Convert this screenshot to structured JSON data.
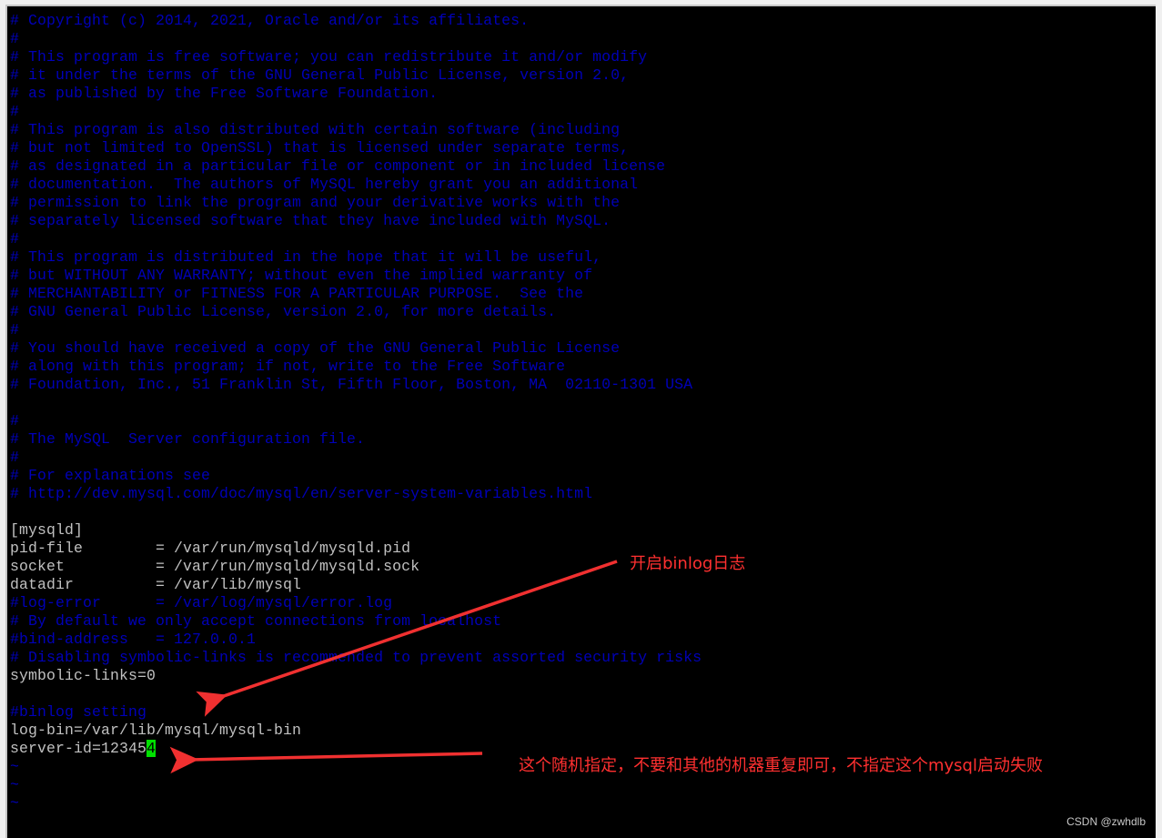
{
  "terminal": {
    "lines": [
      {
        "text": "# Copyright (c) 2014, 2021, Oracle and/or its affiliates.",
        "kind": "comment"
      },
      {
        "text": "#",
        "kind": "comment"
      },
      {
        "text": "# This program is free software; you can redistribute it and/or modify",
        "kind": "comment"
      },
      {
        "text": "# it under the terms of the GNU General Public License, version 2.0,",
        "kind": "comment"
      },
      {
        "text": "# as published by the Free Software Foundation.",
        "kind": "comment"
      },
      {
        "text": "#",
        "kind": "comment"
      },
      {
        "text": "# This program is also distributed with certain software (including",
        "kind": "comment"
      },
      {
        "text": "# but not limited to OpenSSL) that is licensed under separate terms,",
        "kind": "comment"
      },
      {
        "text": "# as designated in a particular file or component or in included license",
        "kind": "comment"
      },
      {
        "text": "# documentation.  The authors of MySQL hereby grant you an additional",
        "kind": "comment"
      },
      {
        "text": "# permission to link the program and your derivative works with the",
        "kind": "comment"
      },
      {
        "text": "# separately licensed software that they have included with MySQL.",
        "kind": "comment"
      },
      {
        "text": "#",
        "kind": "comment"
      },
      {
        "text": "# This program is distributed in the hope that it will be useful,",
        "kind": "comment"
      },
      {
        "text": "# but WITHOUT ANY WARRANTY; without even the implied warranty of",
        "kind": "comment"
      },
      {
        "text": "# MERCHANTABILITY or FITNESS FOR A PARTICULAR PURPOSE.  See the",
        "kind": "comment"
      },
      {
        "text": "# GNU General Public License, version 2.0, for more details.",
        "kind": "comment"
      },
      {
        "text": "#",
        "kind": "comment"
      },
      {
        "text": "# You should have received a copy of the GNU General Public License",
        "kind": "comment"
      },
      {
        "text": "# along with this program; if not, write to the Free Software",
        "kind": "comment"
      },
      {
        "text": "# Foundation, Inc., 51 Franklin St, Fifth Floor, Boston, MA  02110-1301 USA",
        "kind": "comment"
      },
      {
        "text": "",
        "kind": "text"
      },
      {
        "text": "#",
        "kind": "comment"
      },
      {
        "text": "# The MySQL  Server configuration file.",
        "kind": "comment"
      },
      {
        "text": "#",
        "kind": "comment"
      },
      {
        "text": "# For explanations see",
        "kind": "comment"
      },
      {
        "text": "# http://dev.mysql.com/doc/mysql/en/server-system-variables.html",
        "kind": "comment"
      },
      {
        "text": "",
        "kind": "text"
      },
      {
        "text": "[mysqld]",
        "kind": "text"
      },
      {
        "text": "pid-file        = /var/run/mysqld/mysqld.pid",
        "kind": "text"
      },
      {
        "text": "socket          = /var/run/mysqld/mysqld.sock",
        "kind": "text"
      },
      {
        "text": "datadir         = /var/lib/mysql",
        "kind": "text"
      },
      {
        "text": "#log-error      = /var/log/mysql/error.log",
        "kind": "comment"
      },
      {
        "text": "# By default we only accept connections from localhost",
        "kind": "comment"
      },
      {
        "text": "#bind-address   = 127.0.0.1",
        "kind": "comment"
      },
      {
        "text": "# Disabling symbolic-links is recommended to prevent assorted security risks",
        "kind": "comment"
      },
      {
        "text": "symbolic-links=0",
        "kind": "text"
      },
      {
        "text": "",
        "kind": "text"
      },
      {
        "text": "#binlog setting",
        "kind": "comment"
      },
      {
        "text": "log-bin=/var/lib/mysql/mysql-bin",
        "kind": "text"
      },
      {
        "text": "server-id=12345",
        "kind": "text",
        "cursor": "4"
      },
      {
        "text": "~",
        "kind": "tilde"
      },
      {
        "text": "~",
        "kind": "tilde"
      },
      {
        "text": "~",
        "kind": "tilde"
      }
    ]
  },
  "annotations": {
    "binlog_note": "开启binlog日志",
    "server_id_note": "这个随机指定，不要和其他的机器重复即可，不指定这个mysql启动失败"
  },
  "watermark": "CSDN @zwhdlb",
  "colors": {
    "comment": "#0000b8",
    "text": "#c0c0c0",
    "cursor": "#00e000",
    "annotation": "#ff3030"
  }
}
